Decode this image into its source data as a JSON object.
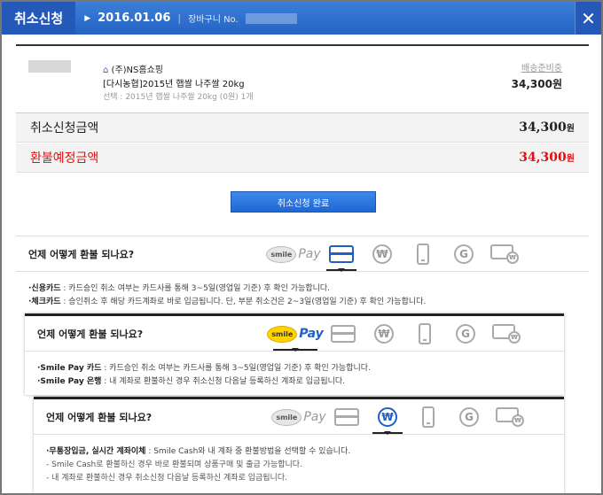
{
  "header": {
    "title": "취소신청",
    "arrow": "▶",
    "date": "2016.01.06",
    "cart_label": "장바구니 No.",
    "close": "✕"
  },
  "order": {
    "shop_icon": "⌂",
    "shop": "(주)NS홈쇼핑",
    "product": "[다시농협]2015년 햅쌀 나주쌀 20kg",
    "option": "선택 : 2015년 햅쌀 나주쌀 20kg (0원) 1개",
    "ship_label": "배송준비중",
    "ship_price": "34,300원"
  },
  "summary": {
    "cancel_label": "취소신청금액",
    "cancel_amount": "34,300",
    "refund_label": "환불예정금액",
    "refund_amount": "34,300",
    "unit": "원"
  },
  "done_button": "취소신청 완료",
  "icons": {
    "smile": "smile",
    "pay": "Pay",
    "won": "₩",
    "g": "G"
  },
  "sections": [
    {
      "question": "언제 어떻게 환불 되나요?",
      "lines": [
        {
          "bold": "·신용카드",
          "text": " : 카드승인 취소 여부는 카드사를 통해 3~5일(영업일 기준) 후 확인 가능합니다."
        },
        {
          "bold": "·체크카드",
          "text": " : 승인취소 후 해당 카드계좌로 바로 입금됩니다. 단, 부분 취소건은 2~3일(영업일 기준) 후 확인 가능합니다."
        }
      ]
    },
    {
      "question": "언제 어떻게 환불 되나요?",
      "lines": [
        {
          "bold": "·Smile Pay 카드",
          "text": " : 카드승인 취소 여부는 카드사를 통해 3~5일(영업일 기준) 후 확인 가능합니다."
        },
        {
          "bold": "·Smile Pay 은행",
          "text": " : 내 계좌로 환불하신 경우 취소신청 다음날 등록하신 계좌로 입금됩니다."
        }
      ]
    },
    {
      "question": "언제 어떻게 환불 되나요?",
      "lines": [
        {
          "bold": "·무통장입금, 실시간 계좌이체",
          "text": " : Smile Cash와 내 계좌 중 환불방법을 선택할 수 있습니다."
        },
        {
          "bold": "",
          "text": " - Smile Cash로 환불하신 경우 바로 환불되며 상품구매 및 출금 가능합니다."
        },
        {
          "bold": "",
          "text": " - 내 계좌로 환불하신 경우 취소신청 다음날 등록하신 계좌로 입금됩니다."
        }
      ]
    }
  ]
}
